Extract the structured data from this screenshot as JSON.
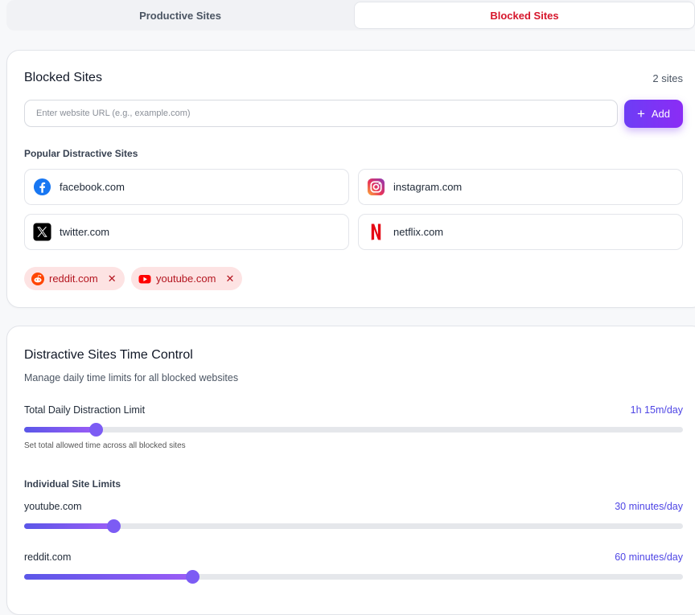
{
  "tabs": [
    {
      "label": "Productive Sites",
      "active": false
    },
    {
      "label": "Blocked Sites",
      "active": true
    }
  ],
  "blocked_card": {
    "title": "Blocked Sites",
    "count": "2 sites",
    "input_placeholder": "Enter website URL (e.g., example.com)",
    "input_value": "",
    "add_label": "Add",
    "popular_title": "Popular Distractive Sites",
    "popular": [
      {
        "label": "facebook.com",
        "icon": "facebook-icon"
      },
      {
        "label": "instagram.com",
        "icon": "instagram-icon"
      },
      {
        "label": "twitter.com",
        "icon": "x-twitter-icon"
      },
      {
        "label": "netflix.com",
        "icon": "netflix-icon"
      }
    ],
    "blocked": [
      {
        "label": "reddit.com",
        "icon": "reddit-icon",
        "remove": "✕"
      },
      {
        "label": "youtube.com",
        "icon": "youtube-icon",
        "remove": "✕"
      }
    ]
  },
  "time_card": {
    "title": "Distractive Sites Time Control",
    "subtitle": "Manage daily time limits for all blocked websites",
    "total_label": "Total Daily Distraction Limit",
    "total_value": "1h 15m/day",
    "total_fraction": 0.109,
    "total_help": "Set total allowed time across all blocked sites",
    "individual_title": "Individual Site Limits",
    "sites": [
      {
        "label": "youtube.com",
        "value": "30 minutes/day",
        "fraction": 0.135
      },
      {
        "label": "reddit.com",
        "value": "60 minutes/day",
        "fraction": 0.255
      }
    ]
  },
  "colors": {
    "accent": "#7c3aed",
    "blocked_tab": "#d6162c",
    "chip_bg": "#fde3e3",
    "value_text": "#4f46e5"
  }
}
